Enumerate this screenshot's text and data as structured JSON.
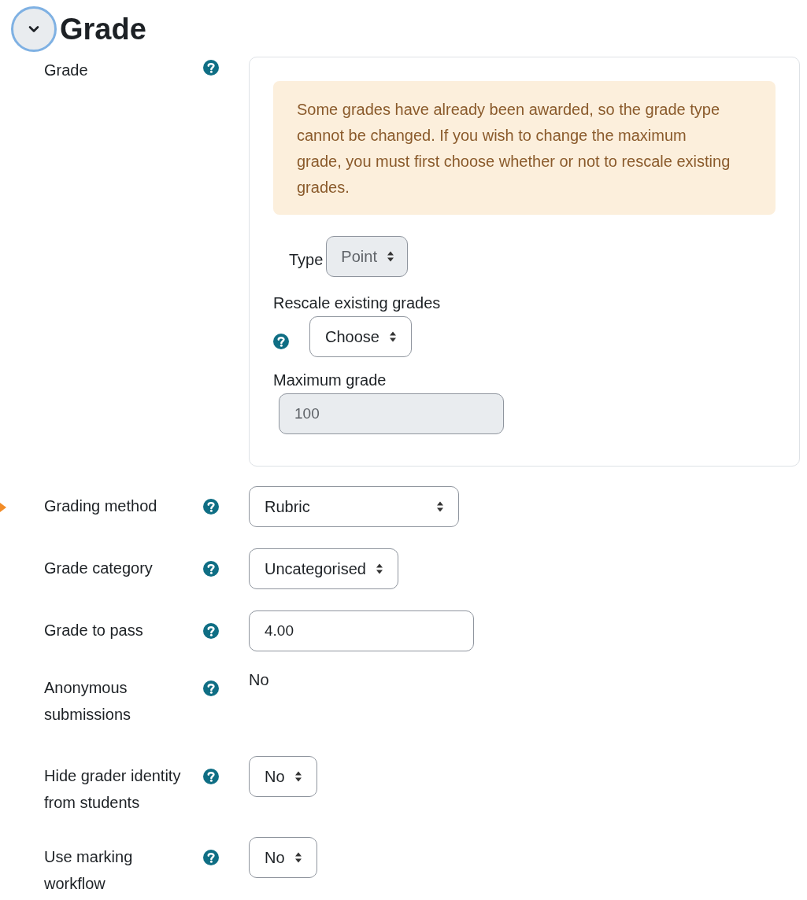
{
  "section": {
    "title": "Grade",
    "expanded": true
  },
  "grade": {
    "label": "Grade",
    "notice": "Some grades have already been awarded, so the grade type cannot be changed. If you wish to change the maximum grade, you must first choose whether or not to rescale existing grades.",
    "type": {
      "label": "Type",
      "value": "Point",
      "disabled": true
    },
    "rescale": {
      "label": "Rescale existing grades",
      "value": "Choose",
      "disabled": false
    },
    "maximum": {
      "label": "Maximum grade",
      "value": "100",
      "disabled": true
    }
  },
  "fields": [
    {
      "label": "Grading method",
      "kind": "select",
      "value": "Rubric",
      "pointed": true
    },
    {
      "label": "Grade category",
      "kind": "select",
      "value": "Uncategorised",
      "pointed": false
    },
    {
      "label": "Grade to pass",
      "kind": "text",
      "value": "4.00",
      "pointed": false
    },
    {
      "label": "Anonymous submissions",
      "kind": "static",
      "value": "No",
      "pointed": false
    },
    {
      "label": "Hide grader identity from students",
      "kind": "select",
      "value": "No",
      "pointed": false
    },
    {
      "label": "Use marking workflow",
      "kind": "select",
      "value": "No",
      "pointed": false
    }
  ]
}
